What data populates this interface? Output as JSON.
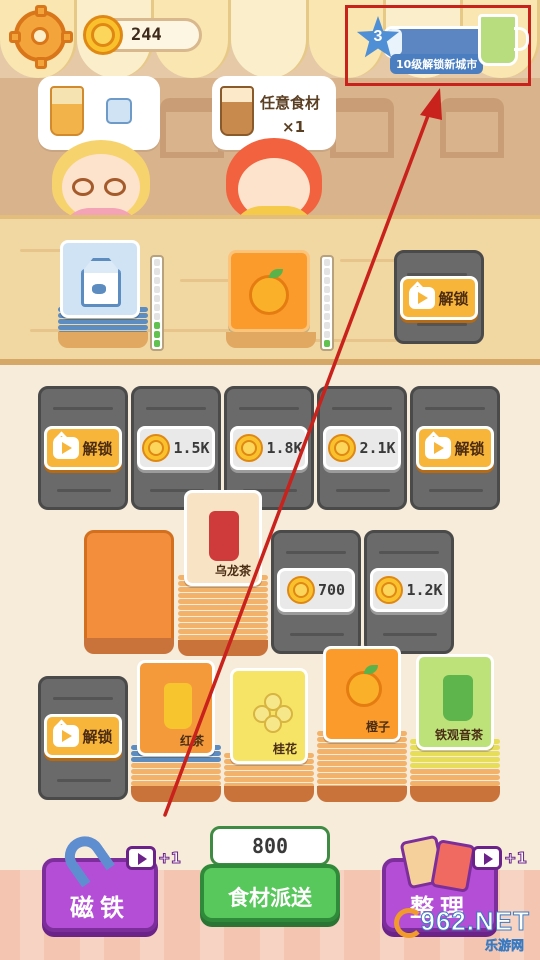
{
  "header": {
    "coins": "244",
    "level": "3",
    "level_progress": 0.15,
    "level_hint": "10级解锁新城市",
    "settings_icon": "gear-icon",
    "goal_icon": "cup-icon"
  },
  "customers": [
    {
      "order_items": [
        "milk-tea-icon",
        "milk-carton-icon"
      ]
    },
    {
      "order_text": "任意食材",
      "order_qty": "×1",
      "order_icon": "bubble-tea-icon"
    }
  ],
  "counter": {
    "slots": [
      {
        "item": "milk-carton",
        "meter_level": 3,
        "meter_max": 10
      },
      {
        "item": "orange",
        "meter_level": 1,
        "meter_max": 10
      },
      {
        "unlock_label": "解锁"
      }
    ]
  },
  "board": {
    "row1": [
      {
        "type": "unlock",
        "label": "解锁"
      },
      {
        "type": "price",
        "price": "1.5K"
      },
      {
        "type": "price",
        "price": "1.8K"
      },
      {
        "type": "price",
        "price": "2.1K"
      },
      {
        "type": "unlock",
        "label": "解锁"
      }
    ],
    "row2": [
      {
        "type": "empty"
      },
      {
        "type": "card",
        "label": "乌龙茶"
      },
      {
        "type": "price",
        "price": "700"
      },
      {
        "type": "price",
        "price": "1.2K"
      }
    ],
    "row3": [
      {
        "type": "unlock",
        "label": "解锁"
      },
      {
        "type": "card",
        "label": "红茶"
      },
      {
        "type": "card",
        "label": "桂花"
      },
      {
        "type": "card",
        "label": "橙子"
      },
      {
        "type": "card",
        "label": "铁观音茶"
      }
    ]
  },
  "actions": {
    "magnet_label": "磁铁",
    "magnet_bonus": "+1",
    "deal_count": "800",
    "deal_label": "食材派送",
    "sort_label": "整理",
    "sort_bonus": "+1"
  },
  "watermark": {
    "brand": "962.NET",
    "sub": "乐游网"
  },
  "colors": {
    "annotation": "#c9211c",
    "deal_button": "#58c75c",
    "tool_button": "#b44ed6"
  }
}
